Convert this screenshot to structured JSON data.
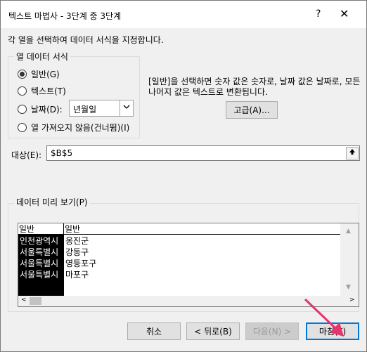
{
  "window": {
    "title": "텍스트 마법사 - 3단계 중 3단계",
    "help_label": "?",
    "close_label": "✕"
  },
  "instruction": "각 열을 선택하여 데이터 서식을 지정합니다.",
  "column_format": {
    "group_label": "열 데이터 서식",
    "options": [
      {
        "label": "일반(G)",
        "checked": true
      },
      {
        "label": "텍스트(T)",
        "checked": false
      },
      {
        "label": "날짜(D):",
        "checked": false
      },
      {
        "label": "열 가져오지 않음(건너뜀)(I)",
        "checked": false
      }
    ],
    "date_value": "년월일",
    "dropdown_icon": "chevron-down-icon"
  },
  "description": "[일반]을 선택하면 숫자 값은 숫자로, 날짜 값은 날짜로, 모든 나머지 값은 텍스트로 변환됩니다.",
  "advanced_button": "고급(A)...",
  "destination": {
    "label": "대상(E):",
    "value": "$B$5",
    "collapse_icon": "collapse-dialog-icon"
  },
  "preview": {
    "label": "데이터 미리 보기(P)",
    "headers": [
      "일반",
      "일반"
    ],
    "rows": [
      [
        "인천광역시",
        "옹진군"
      ],
      [
        "서울특별시",
        "강동구"
      ],
      [
        "서울특별시",
        "영등포구"
      ],
      [
        "서울특별시",
        "마포구"
      ]
    ],
    "scroll_up_icon": "▲",
    "scroll_down_icon": "▼",
    "scroll_left_icon": "<",
    "scroll_right_icon": ">"
  },
  "buttons": {
    "cancel": "취소",
    "back": "< 뒤로(B)",
    "next": "다음(N) >",
    "finish": "마침(F)"
  },
  "colors": {
    "accent": "#0078d7",
    "pointer_arrow": "#e8336d"
  }
}
